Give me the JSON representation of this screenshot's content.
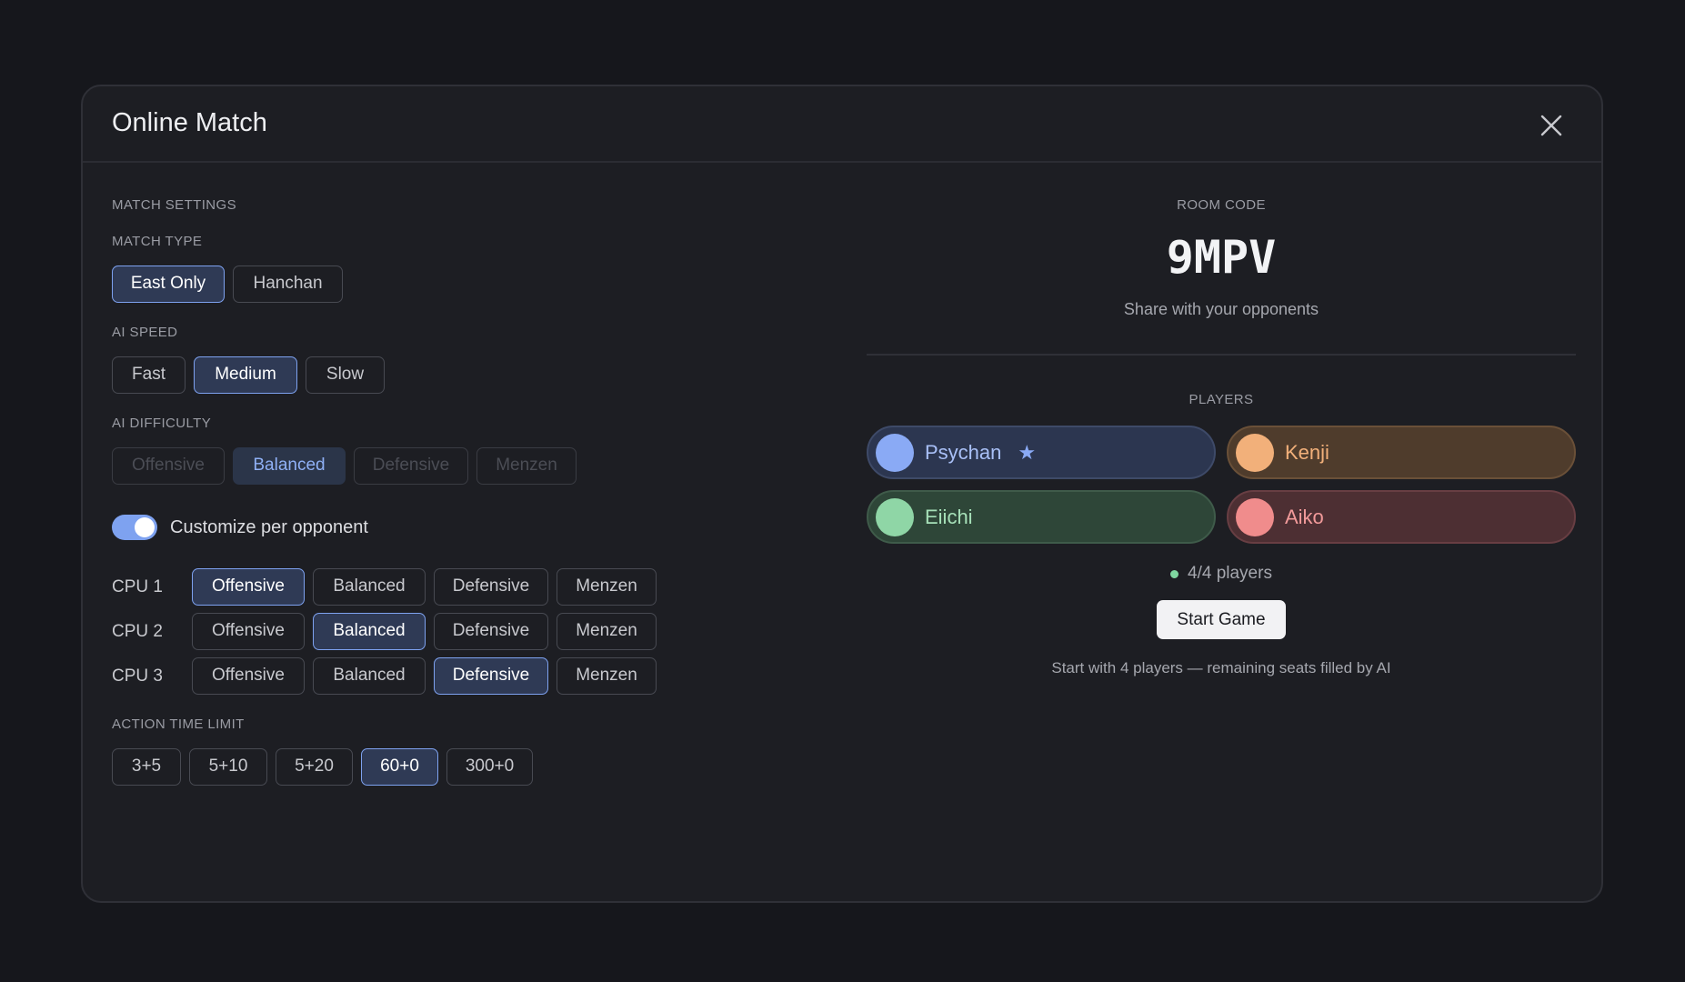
{
  "modal": {
    "title": "Online Match"
  },
  "settings": {
    "section_label": "MATCH SETTINGS",
    "match_type": {
      "label": "MATCH TYPE",
      "options": [
        "East Only",
        "Hanchan"
      ],
      "selected": "East Only"
    },
    "ai_speed": {
      "label": "AI SPEED",
      "options": [
        "Fast",
        "Medium",
        "Slow"
      ],
      "selected": "Medium"
    },
    "ai_difficulty": {
      "label": "AI DIFFICULTY",
      "options": [
        "Offensive",
        "Balanced",
        "Defensive",
        "Menzen"
      ],
      "selected": "Balanced",
      "disabled": true
    },
    "customize": {
      "label": "Customize per opponent",
      "enabled": true
    },
    "cpus": [
      {
        "label": "CPU 1",
        "options": [
          "Offensive",
          "Balanced",
          "Defensive",
          "Menzen"
        ],
        "selected": "Offensive"
      },
      {
        "label": "CPU 2",
        "options": [
          "Offensive",
          "Balanced",
          "Defensive",
          "Menzen"
        ],
        "selected": "Balanced"
      },
      {
        "label": "CPU 3",
        "options": [
          "Offensive",
          "Balanced",
          "Defensive",
          "Menzen"
        ],
        "selected": "Defensive"
      }
    ],
    "time_limit": {
      "label": "ACTION TIME LIMIT",
      "options": [
        "3+5",
        "5+10",
        "5+20",
        "60+0",
        "300+0"
      ],
      "selected": "60+0"
    }
  },
  "room": {
    "label": "ROOM CODE",
    "code": "9MPV",
    "share_text": "Share with your opponents"
  },
  "players": {
    "label": "PLAYERS",
    "list": [
      {
        "name": "Psychan",
        "host": true,
        "star": "★",
        "color": "#8aaaf5",
        "bg": "#2c3650",
        "border": "#3e4a68",
        "text": "#a9c0f7"
      },
      {
        "name": "Kenji",
        "host": false,
        "color": "#f2b07a",
        "bg": "#4f3c2c",
        "border": "#6a5038",
        "text": "#f2b07a"
      },
      {
        "name": "Eiichi",
        "host": false,
        "color": "#8fd6a6",
        "bg": "#2e4638",
        "border": "#3f5b4a",
        "text": "#a6e0b8"
      },
      {
        "name": "Aiko",
        "host": false,
        "color": "#f08c8c",
        "bg": "#4d2f33",
        "border": "#683e43",
        "text": "#f29a9a"
      }
    ],
    "status": "4/4 players"
  },
  "actions": {
    "start_label": "Start Game",
    "note": "Start with 4 players — remaining seats filled by AI"
  },
  "colors": {
    "accent": "#7ea2f0",
    "background": "#16171c",
    "panel": "#1d1e23"
  }
}
